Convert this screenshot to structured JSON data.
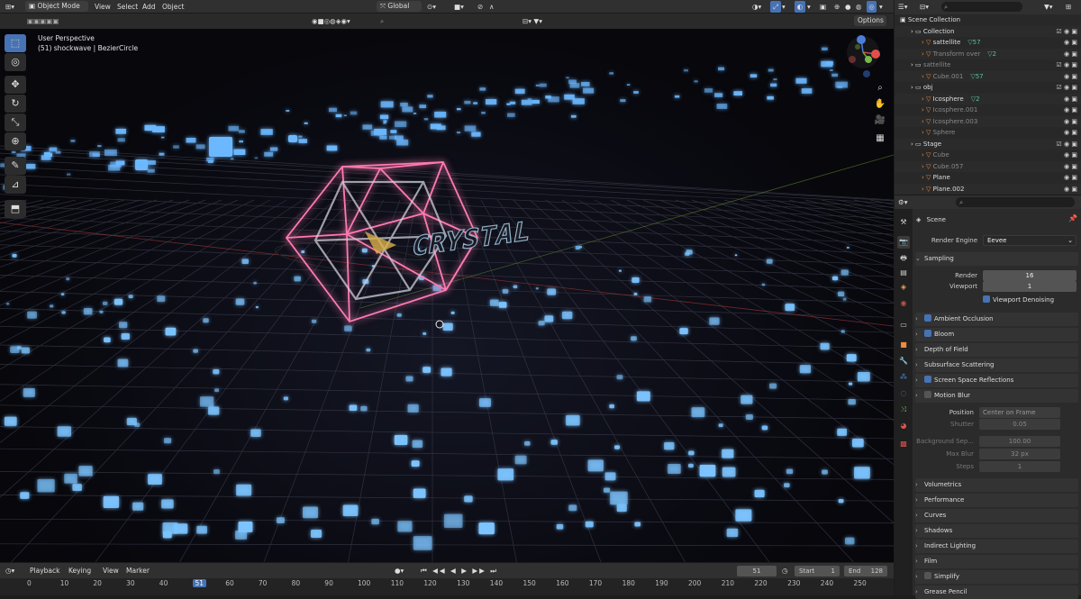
{
  "viewport_header": {
    "mode": "Object Mode",
    "menus": [
      "View",
      "Select",
      "Add",
      "Object"
    ],
    "transform_orientation": "Global",
    "options_label": "Options"
  },
  "viewport": {
    "perspective": "User Perspective",
    "active_object": "(51) shockwave | BezierCircle",
    "scene_text": "CRYSTAL"
  },
  "timeline": {
    "menus": [
      "Playback",
      "Keying",
      "View",
      "Marker"
    ],
    "current_frame": "51",
    "start_label": "Start",
    "start_value": "1",
    "end_label": "End",
    "end_value": "128",
    "ticks": [
      "0",
      "10",
      "20",
      "30",
      "40",
      "51",
      "60",
      "70",
      "80",
      "90",
      "100",
      "110",
      "120",
      "130",
      "140",
      "150",
      "160",
      "170",
      "180",
      "190",
      "200",
      "210",
      "220",
      "230",
      "240",
      "250"
    ]
  },
  "outliner": {
    "rows": [
      {
        "label": "Scene Collection",
        "level": 0,
        "type": "scene"
      },
      {
        "label": "Collection",
        "level": 1,
        "type": "collection"
      },
      {
        "label": "sattellite",
        "level": 2,
        "type": "object",
        "extra": "57"
      },
      {
        "label": "Transform over",
        "level": 2,
        "type": "object",
        "extra": "2",
        "dim": true
      },
      {
        "label": "sattellite",
        "level": 1,
        "type": "collection",
        "dim": true
      },
      {
        "label": "Cube.001",
        "level": 2,
        "type": "object",
        "extra": "57",
        "dim": true
      },
      {
        "label": "obj",
        "level": 1,
        "type": "collection"
      },
      {
        "label": "Icosphere",
        "level": 2,
        "type": "object",
        "extra": "2"
      },
      {
        "label": "Icosphere.001",
        "level": 2,
        "type": "object",
        "dim": true
      },
      {
        "label": "Icosphere.003",
        "level": 2,
        "type": "object",
        "dim": true
      },
      {
        "label": "Sphere",
        "level": 2,
        "type": "object",
        "dim": true
      },
      {
        "label": "Stage",
        "level": 1,
        "type": "collection"
      },
      {
        "label": "Cube",
        "level": 2,
        "type": "object",
        "dim": true
      },
      {
        "label": "Cube.057",
        "level": 2,
        "type": "object",
        "dim": true
      },
      {
        "label": "Plane",
        "level": 2,
        "type": "object"
      },
      {
        "label": "Plane.002",
        "level": 2,
        "type": "object"
      }
    ]
  },
  "properties": {
    "scene_label": "Scene",
    "render_engine_label": "Render Engine",
    "render_engine": "Eevee",
    "sampling_label": "Sampling",
    "render_label": "Render",
    "render_value": "16",
    "viewport_label": "Viewport",
    "viewport_value": "1",
    "viewport_denoising": "Viewport Denoising",
    "panels": [
      {
        "label": "Ambient Occlusion",
        "checkbox": true
      },
      {
        "label": "Bloom",
        "checkbox": true
      },
      {
        "label": "Depth of Field",
        "checkbox": null
      },
      {
        "label": "Subsurface Scattering",
        "checkbox": null
      },
      {
        "label": "Screen Space Reflections",
        "checkbox": true
      },
      {
        "label": "Motion Blur",
        "checkbox": false
      }
    ],
    "motion_blur": {
      "position_label": "Position",
      "position_value": "Center on Frame",
      "shutter_label": "Shutter",
      "shutter_value": "0.05",
      "bg_sep_label": "Background Sep...",
      "bg_sep_value": "100.00",
      "max_blur_label": "Max Blur",
      "max_blur_value": "32 px",
      "steps_label": "Steps",
      "steps_value": "1"
    },
    "lower_panels": [
      {
        "label": "Volumetrics",
        "checkbox": null
      },
      {
        "label": "Performance",
        "checkbox": null
      },
      {
        "label": "Curves",
        "checkbox": null
      },
      {
        "label": "Shadows",
        "checkbox": null
      },
      {
        "label": "Indirect Lighting",
        "checkbox": null
      },
      {
        "label": "Film",
        "checkbox": null
      },
      {
        "label": "Simplify",
        "checkbox": false
      },
      {
        "label": "Grease Pencil",
        "checkbox": null
      }
    ]
  }
}
